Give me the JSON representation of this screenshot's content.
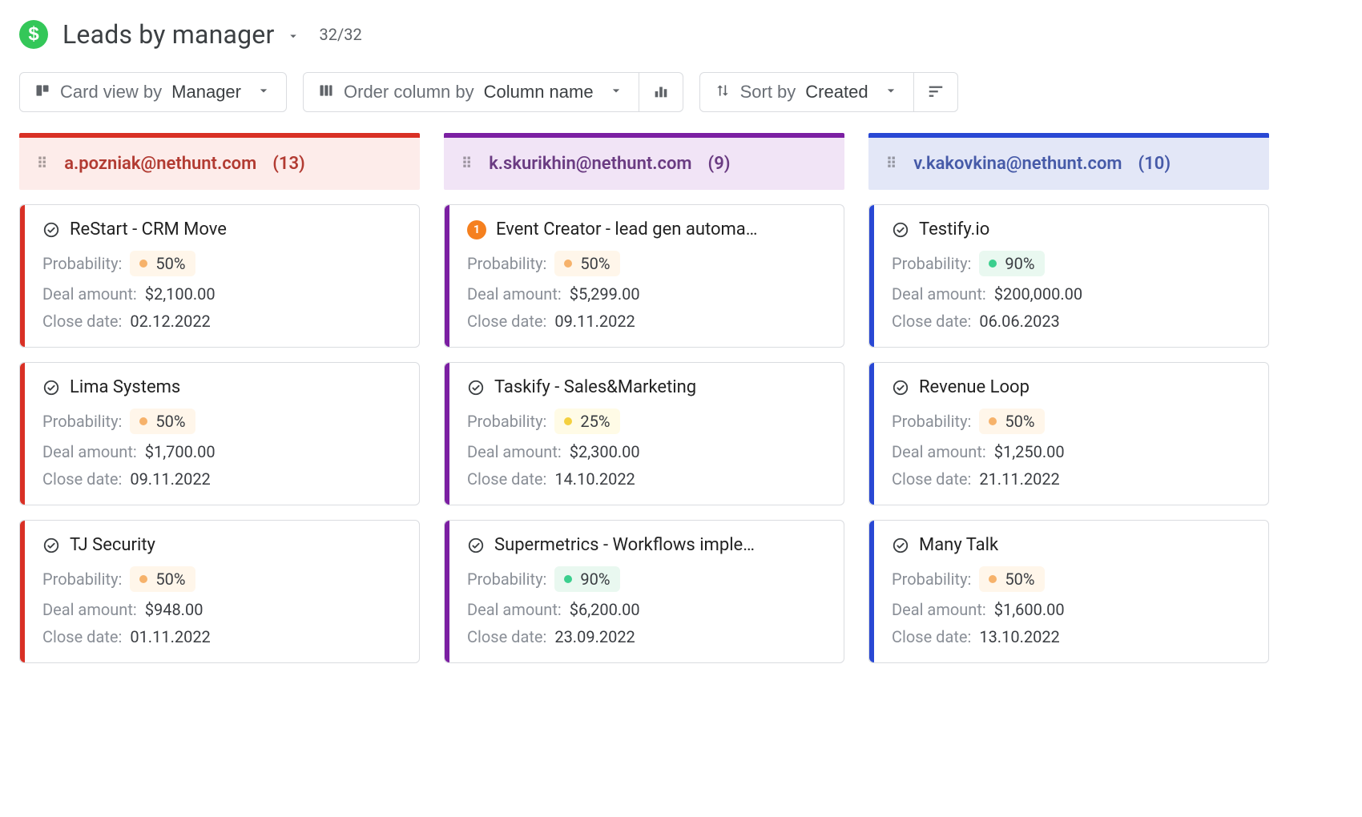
{
  "header": {
    "title": "Leads by manager",
    "count": "32/32"
  },
  "toolbar": {
    "card_view_label": "Card view by",
    "card_view_value": "Manager",
    "order_label": "Order column by",
    "order_value": "Column name",
    "sort_label": "Sort by",
    "sort_value": "Created"
  },
  "columns": [
    {
      "color_class": "col-red",
      "email": "a.pozniak@nethunt.com",
      "count": "(13)",
      "cards": [
        {
          "icon": "check-circle",
          "title": "ReStart - CRM Move",
          "probability_label": "Probability:",
          "probability_value": "50%",
          "probability_color": "orange",
          "deal_label": "Deal amount:",
          "deal_value": "$2,100.00",
          "close_label": "Close date:",
          "close_value": "02.12.2022"
        },
        {
          "icon": "check-circle",
          "title": "Lima Systems",
          "probability_label": "Probability:",
          "probability_value": "50%",
          "probability_color": "orange",
          "deal_label": "Deal amount:",
          "deal_value": "$1,700.00",
          "close_label": "Close date:",
          "close_value": "09.11.2022"
        },
        {
          "icon": "check-circle",
          "title": "TJ Security",
          "probability_label": "Probability:",
          "probability_value": "50%",
          "probability_color": "orange",
          "deal_label": "Deal amount:",
          "deal_value": "$948.00",
          "close_label": "Close date:",
          "close_value": "01.11.2022"
        }
      ]
    },
    {
      "color_class": "col-purple",
      "email": "k.skurikhin@nethunt.com",
      "count": "(9)",
      "cards": [
        {
          "icon": "notif",
          "notif_value": "1",
          "title": "Event Creator - lead gen automa…",
          "probability_label": "Probability:",
          "probability_value": "50%",
          "probability_color": "orange",
          "deal_label": "Deal amount:",
          "deal_value": "$5,299.00",
          "close_label": "Close date:",
          "close_value": "09.11.2022"
        },
        {
          "icon": "check-circle",
          "title": "Taskify - Sales&Marketing",
          "probability_label": "Probability:",
          "probability_value": "25%",
          "probability_color": "yellow",
          "deal_label": "Deal amount:",
          "deal_value": "$2,300.00",
          "close_label": "Close date:",
          "close_value": "14.10.2022"
        },
        {
          "icon": "check-circle",
          "title": "Supermetrics - Workflows imple…",
          "probability_label": "Probability:",
          "probability_value": "90%",
          "probability_color": "green",
          "deal_label": "Deal amount:",
          "deal_value": "$6,200.00",
          "close_label": "Close date:",
          "close_value": "23.09.2022"
        }
      ]
    },
    {
      "color_class": "col-blue",
      "email": "v.kakovkina@nethunt.com",
      "count": "(10)",
      "cards": [
        {
          "icon": "check-circle",
          "title": "Testify.io",
          "probability_label": "Probability:",
          "probability_value": "90%",
          "probability_color": "green",
          "deal_label": "Deal amount:",
          "deal_value": "$200,000.00",
          "close_label": "Close date:",
          "close_value": "06.06.2023"
        },
        {
          "icon": "check-circle",
          "title": "Revenue Loop",
          "probability_label": "Probability:",
          "probability_value": "50%",
          "probability_color": "orange",
          "deal_label": "Deal amount:",
          "deal_value": "$1,250.00",
          "close_label": "Close date:",
          "close_value": "21.11.2022"
        },
        {
          "icon": "check-circle",
          "title": "Many Talk",
          "probability_label": "Probability:",
          "probability_value": "50%",
          "probability_color": "orange",
          "deal_label": "Deal amount:",
          "deal_value": "$1,600.00",
          "close_label": "Close date:",
          "close_value": "13.10.2022"
        }
      ]
    }
  ]
}
